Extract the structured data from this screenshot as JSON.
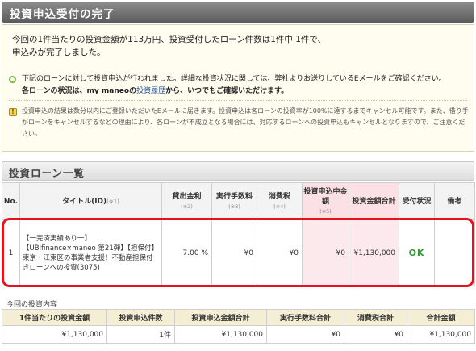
{
  "header": {
    "title": "投資申込受付の完了"
  },
  "message": {
    "lead_line1": "今回の1件当たりの投資金額が113万円、投資受付したローン件数は1件中 1件で、",
    "lead_line2": "申込みが完了しました。"
  },
  "notice": {
    "line1": "下記のローンに対して投資申込が行われました。詳細な投資状況に関しては、弊社よりお送りしているEメールをご確認ください。",
    "line2_prefix": "各ローンの状況は、my maneoの",
    "line2_link": "投資履歴",
    "line2_suffix": "から、いつでもご確認いただけます。"
  },
  "caution": {
    "text": "投資申込の結果は数分以内にご登録いただいたEメールに届きます。投資申込は各ローンの投資率が100%に達するまでキャンセル可能です。また、借り手がローンをキャンセルするなどの理由により、各ローンが不成立となる場合には、対応するローンへの投資申込もキャンセルとなりますので、ご注意ください。"
  },
  "loan_section": {
    "title": "投資ローン一覧",
    "columns": [
      {
        "label": "No.",
        "note": ""
      },
      {
        "label": "タイトル(ID)",
        "note": "(※1)"
      },
      {
        "label": "貸出金利",
        "note": "(※2)"
      },
      {
        "label": "実行手数料",
        "note": "(※3)"
      },
      {
        "label": "消費税",
        "note": "(※4)"
      },
      {
        "label": "投資申込中金額",
        "note": "(※5)"
      },
      {
        "label": "投資金額合計",
        "note": ""
      },
      {
        "label": "受付状況",
        "note": ""
      },
      {
        "label": "備考",
        "note": ""
      }
    ],
    "rows": [
      {
        "no": "1",
        "title": "【一完済実績あり一】【UBIfinance×maneo 第21弾】【担保付】東京・江東区の事業者支援！不動産担保付きローンへの投資(3075)",
        "rate": "7.00 %",
        "fee": "¥0",
        "tax": "¥0",
        "pending": "¥0",
        "total": "¥1,130,000",
        "status": "OK",
        "remarks": ""
      }
    ]
  },
  "summary": {
    "label": "今回の投資内容",
    "headers": [
      "1件当たりの投資金額",
      "投資申込件数",
      "投資申込金額合計",
      "実行手数料合計",
      "消費税合計",
      "合計金額"
    ],
    "values": [
      "¥1,130,000",
      "1件",
      "¥1,130,000",
      "¥0",
      "¥0",
      "¥1,130,000"
    ]
  }
}
